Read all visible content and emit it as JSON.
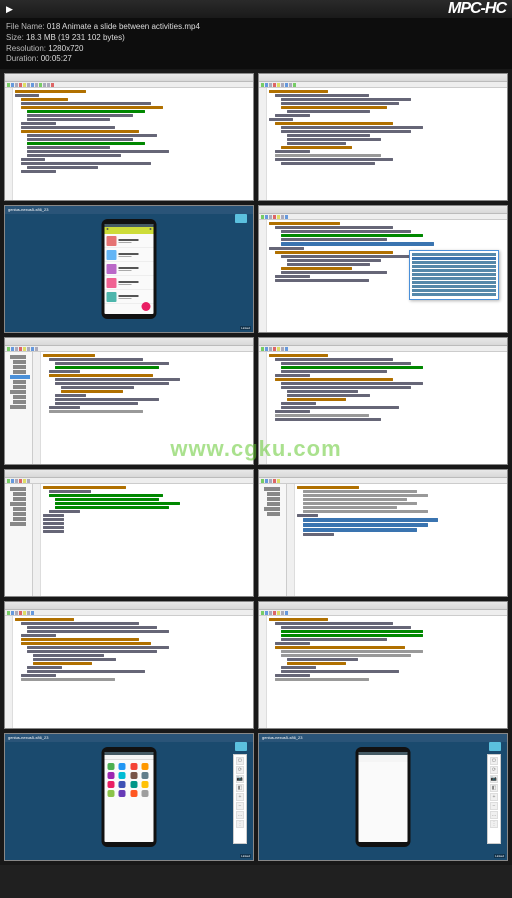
{
  "player": {
    "app_name": "MPC-HC",
    "file_name_label": "File Name:",
    "file_name": "018 Animate a slide between activities.mp4",
    "size_label": "Size:",
    "size": "18.3 MB (19 231 102 bytes)",
    "resolution_label": "Resolution:",
    "resolution": "1280x720",
    "duration_label": "Duration:",
    "duration": "00:05:27"
  },
  "watermark": "www.cgku.com",
  "device_title": "genius-nexus5-x86_23",
  "linkedin": "Linked",
  "app_icons_colors": [
    "#4caf50",
    "#2196f3",
    "#f44336",
    "#ff9800",
    "#9c27b0",
    "#00bcd4",
    "#795548",
    "#607d8b",
    "#e91e63",
    "#3f51b5",
    "#009688",
    "#ffc107",
    "#8bc34a",
    "#673ab7",
    "#ff5722",
    "#9e9e9e"
  ],
  "side_panel_glyphs": [
    "⏻",
    "⟳",
    "📷",
    "◧",
    "+",
    "−",
    "…",
    "⋮"
  ]
}
